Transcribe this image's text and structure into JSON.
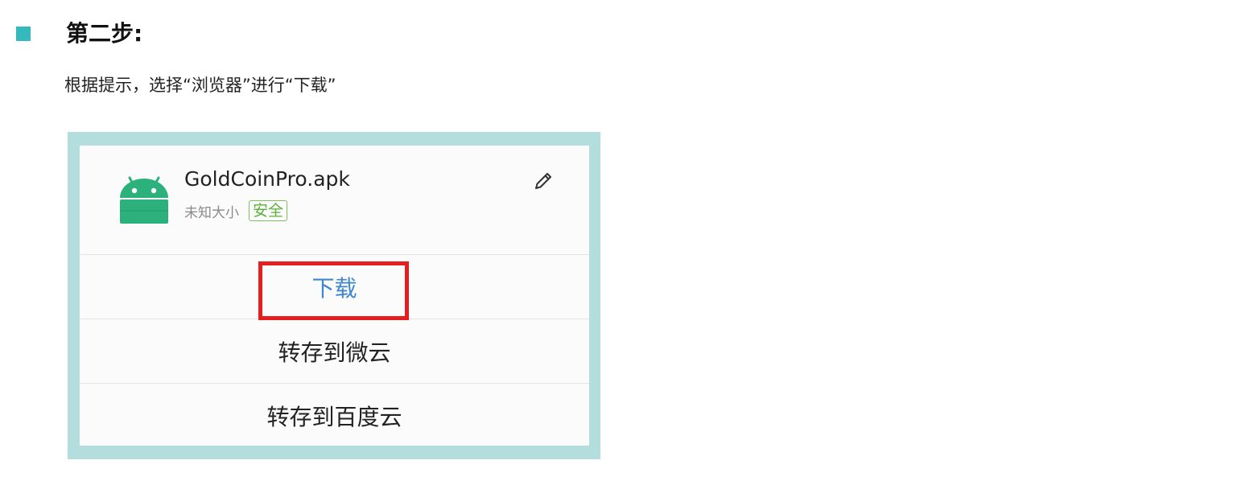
{
  "step": {
    "title": "第二步:",
    "instruction": "根据提示，选择“浏览器”进行“下载”",
    "bullet_color": "#35b9bd"
  },
  "screenshot": {
    "frame_color": "#b3dedd",
    "file": {
      "icon": "android-icon",
      "name": "GoldCoinPro.apk",
      "size": "未知大小",
      "badge": "安全",
      "edit_icon": "pencil-icon"
    },
    "actions": [
      {
        "label": "下载",
        "highlighted": true
      },
      {
        "label": "转存到微云",
        "highlighted": false
      },
      {
        "label": "转存到百度云",
        "highlighted": false
      }
    ],
    "highlight_color": "#e51f1f",
    "accent_color": "#3f86cf",
    "icon_color": "#2db17c",
    "badge_color": "#59b03a"
  }
}
